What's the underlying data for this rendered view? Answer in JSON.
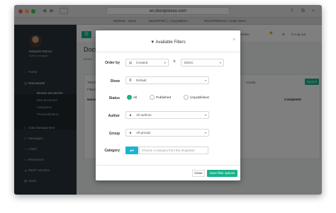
{
  "browser": {
    "url": "en.docxpresso.com",
    "tabs": [
      "MSWUK - Home",
      "MentorPitch [...] ing platform",
      "DOCXPRESSO | Leads intern"
    ]
  },
  "sidebar": {
    "user_name": "Eduardo Ramos",
    "user_role": "Sales manager",
    "items": [
      {
        "label": "Home",
        "icon": "home-icon"
      },
      {
        "label": "Documents",
        "icon": "file-icon"
      },
      {
        "label": "Data Management",
        "icon": "database-icon"
      },
      {
        "label": "Messages",
        "icon": "envelope-icon"
      },
      {
        "label": "Users",
        "icon": "users-icon"
      },
      {
        "label": "Resources",
        "icon": "folder-icon"
      },
      {
        "label": "REST services",
        "icon": "cloud-icon"
      },
      {
        "label": "News",
        "icon": "news-icon"
      }
    ],
    "subitems": [
      "Browse documents",
      "New document",
      "Categories",
      "Previsualization"
    ]
  },
  "header": {
    "menu_icon": "bars-icon",
    "brand_right": "Docxpresso",
    "logout": "Log out"
  },
  "page": {
    "title": "Docu",
    "breadcrumb": "Home",
    "card_texts": [
      "There a",
      "Filtered",
      "Name",
      "Completed",
      "ecurity"
    ],
    "search_label": "Search"
  },
  "modal": {
    "title": "Available Filters",
    "order_by_label": "Order by",
    "order_by_value": "Created",
    "order_dir_value": "DESC",
    "show_label": "Show",
    "show_value": "Default",
    "status_label": "Status",
    "status_options": [
      "All",
      "Published",
      "Unpublished"
    ],
    "status_selected": "All",
    "author_label": "Author",
    "author_value": "All authors",
    "group_label": "Group",
    "group_value": "All groups",
    "category_label": "Category",
    "category_placeholder": "Choose a category from the dropdown",
    "close_label": "Close",
    "save_label": "Save filter options"
  },
  "colors": {
    "accent": "#19b38a",
    "sidebar": "#263238",
    "category_button": "#1cb5d0"
  }
}
